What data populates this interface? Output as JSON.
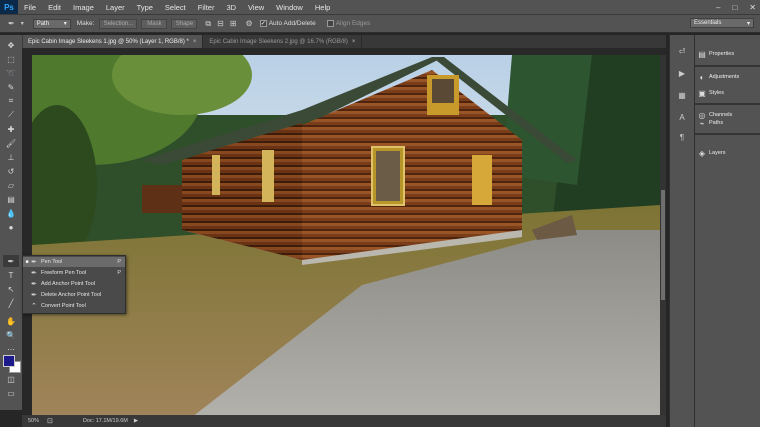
{
  "app": {
    "logo": "Ps"
  },
  "menubar": {
    "items": [
      "File",
      "Edit",
      "Image",
      "Layer",
      "Type",
      "Select",
      "Filter",
      "3D",
      "View",
      "Window",
      "Help"
    ],
    "window_controls": [
      "–",
      "□",
      "✕"
    ]
  },
  "options_bar": {
    "mode_value": "Path",
    "make_label": "Make:",
    "selection_btn": "Selection...",
    "mask_btn": "Mask",
    "shape_btn": "Shape",
    "auto_add_delete_label": "Auto Add/Delete",
    "auto_add_delete_checked": true,
    "align_edges_label": "Align Edges",
    "align_edges_checked": false,
    "workspace_value": "Essentials"
  },
  "tabs": [
    {
      "label": "Epic Cabin Image Sleekens 1.jpg @ 50% (Layer 1, RGB/8) *",
      "close": "×",
      "active": true
    },
    {
      "label": "Epic Cabin Image Sleekens 2.jpg @ 16.7% (RGB/8)",
      "close": "×",
      "active": false
    }
  ],
  "tool_flyout": {
    "items": [
      {
        "label": "Pen Tool",
        "shortcut": "P",
        "selected": true,
        "icon": "pen-icon"
      },
      {
        "label": "Freeform Pen Tool",
        "shortcut": "P",
        "selected": false,
        "icon": "freeform-pen-icon"
      },
      {
        "label": "Add Anchor Point Tool",
        "shortcut": "",
        "selected": false,
        "icon": "add-anchor-icon"
      },
      {
        "label": "Delete Anchor Point Tool",
        "shortcut": "",
        "selected": false,
        "icon": "delete-anchor-icon"
      },
      {
        "label": "Convert Point Tool",
        "shortcut": "",
        "selected": false,
        "icon": "convert-point-icon"
      }
    ]
  },
  "status": {
    "zoom": "50%",
    "doc": "Doc: 17.1M/19.6M",
    "arrow": "▶"
  },
  "panels": [
    {
      "label": "Properties",
      "icon": "properties-icon"
    },
    {
      "label": "Adjustments",
      "icon": "adjustments-icon"
    },
    {
      "label": "Styles",
      "icon": "styles-icon"
    },
    {
      "label": "Channels",
      "icon": "channels-icon"
    },
    {
      "label": "Paths",
      "icon": "paths-icon"
    },
    {
      "label": "Layers",
      "icon": "layers-icon"
    }
  ],
  "colors": {
    "foreground": "#1d1b8c",
    "background": "#ffffff",
    "ui_dark": "#262626",
    "ui_panel": "#535353"
  }
}
